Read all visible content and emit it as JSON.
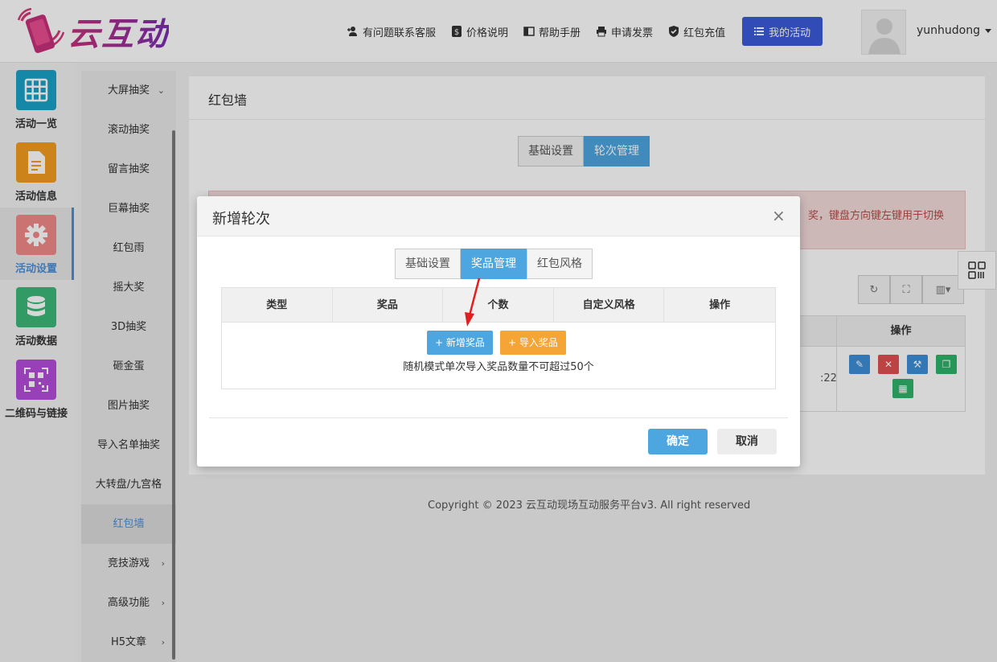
{
  "header": {
    "logo_text": "云互动",
    "nav": [
      {
        "label": "有问题联系客服",
        "icon": "add-user-icon"
      },
      {
        "label": "价格说明",
        "icon": "dollar-icon"
      },
      {
        "label": "帮助手册",
        "icon": "book-icon"
      },
      {
        "label": "申请发票",
        "icon": "printer-icon"
      },
      {
        "label": "红包充值",
        "icon": "shield-check-icon"
      }
    ],
    "my_activity": "我的活动",
    "username": "yunhudong"
  },
  "rail": {
    "items": [
      {
        "label": "活动一览",
        "color": "#1aa3c8",
        "icon": "grid-icon"
      },
      {
        "label": "活动信息",
        "color": "#f29c1f",
        "icon": "document-icon"
      },
      {
        "label": "活动设置",
        "color": "#f08a8a",
        "icon": "gear-icon",
        "active": true
      },
      {
        "label": "活动数据",
        "color": "#3cb878",
        "icon": "database-icon"
      },
      {
        "label": "二维码与链接",
        "color": "#b44ddc",
        "icon": "qrcode-icon"
      }
    ]
  },
  "submenu": {
    "items": [
      {
        "label": "大屏抽奖",
        "arrow": "⌄"
      },
      {
        "label": "滚动抽奖"
      },
      {
        "label": "留言抽奖"
      },
      {
        "label": "巨幕抽奖"
      },
      {
        "label": "红包雨"
      },
      {
        "label": "摇大奖"
      },
      {
        "label": "3D抽奖"
      },
      {
        "label": "砸金蛋"
      },
      {
        "label": "图片抽奖"
      },
      {
        "label": "导入名单抽奖"
      },
      {
        "label": "大转盘/九宫格"
      },
      {
        "label": "红包墙",
        "active": true
      },
      {
        "label": "竞技游戏",
        "arrow": "›"
      },
      {
        "label": "高级功能",
        "arrow": "›"
      },
      {
        "label": "H5文章",
        "arrow": "›"
      }
    ]
  },
  "main": {
    "title": "红包墙",
    "tabs": [
      "基础设置",
      "轮次管理"
    ],
    "alert_text": "奖，键盘方向键左键用于切换",
    "table_header_ops": "操作",
    "row_time": ":22",
    "op_colors": [
      "#3d8fd8",
      "#e05050",
      "#3d8fd8",
      "#2fb36b",
      "#2fb36b"
    ]
  },
  "footer": {
    "copyright": "Copyright © 2023 云互动现场互动服务平台v3. All right reserved"
  },
  "modal": {
    "title": "新增轮次",
    "close": "×",
    "tabs": [
      "基础设置",
      "奖品管理",
      "红包风格"
    ],
    "columns": [
      "类型",
      "奖品",
      "个数",
      "自定义风格",
      "操作"
    ],
    "add_prize": "+ 新增奖品",
    "import_prize": "+ 导入奖品",
    "note": "随机模式单次导入奖品数量不可超过50个",
    "confirm": "确定",
    "cancel": "取消"
  }
}
